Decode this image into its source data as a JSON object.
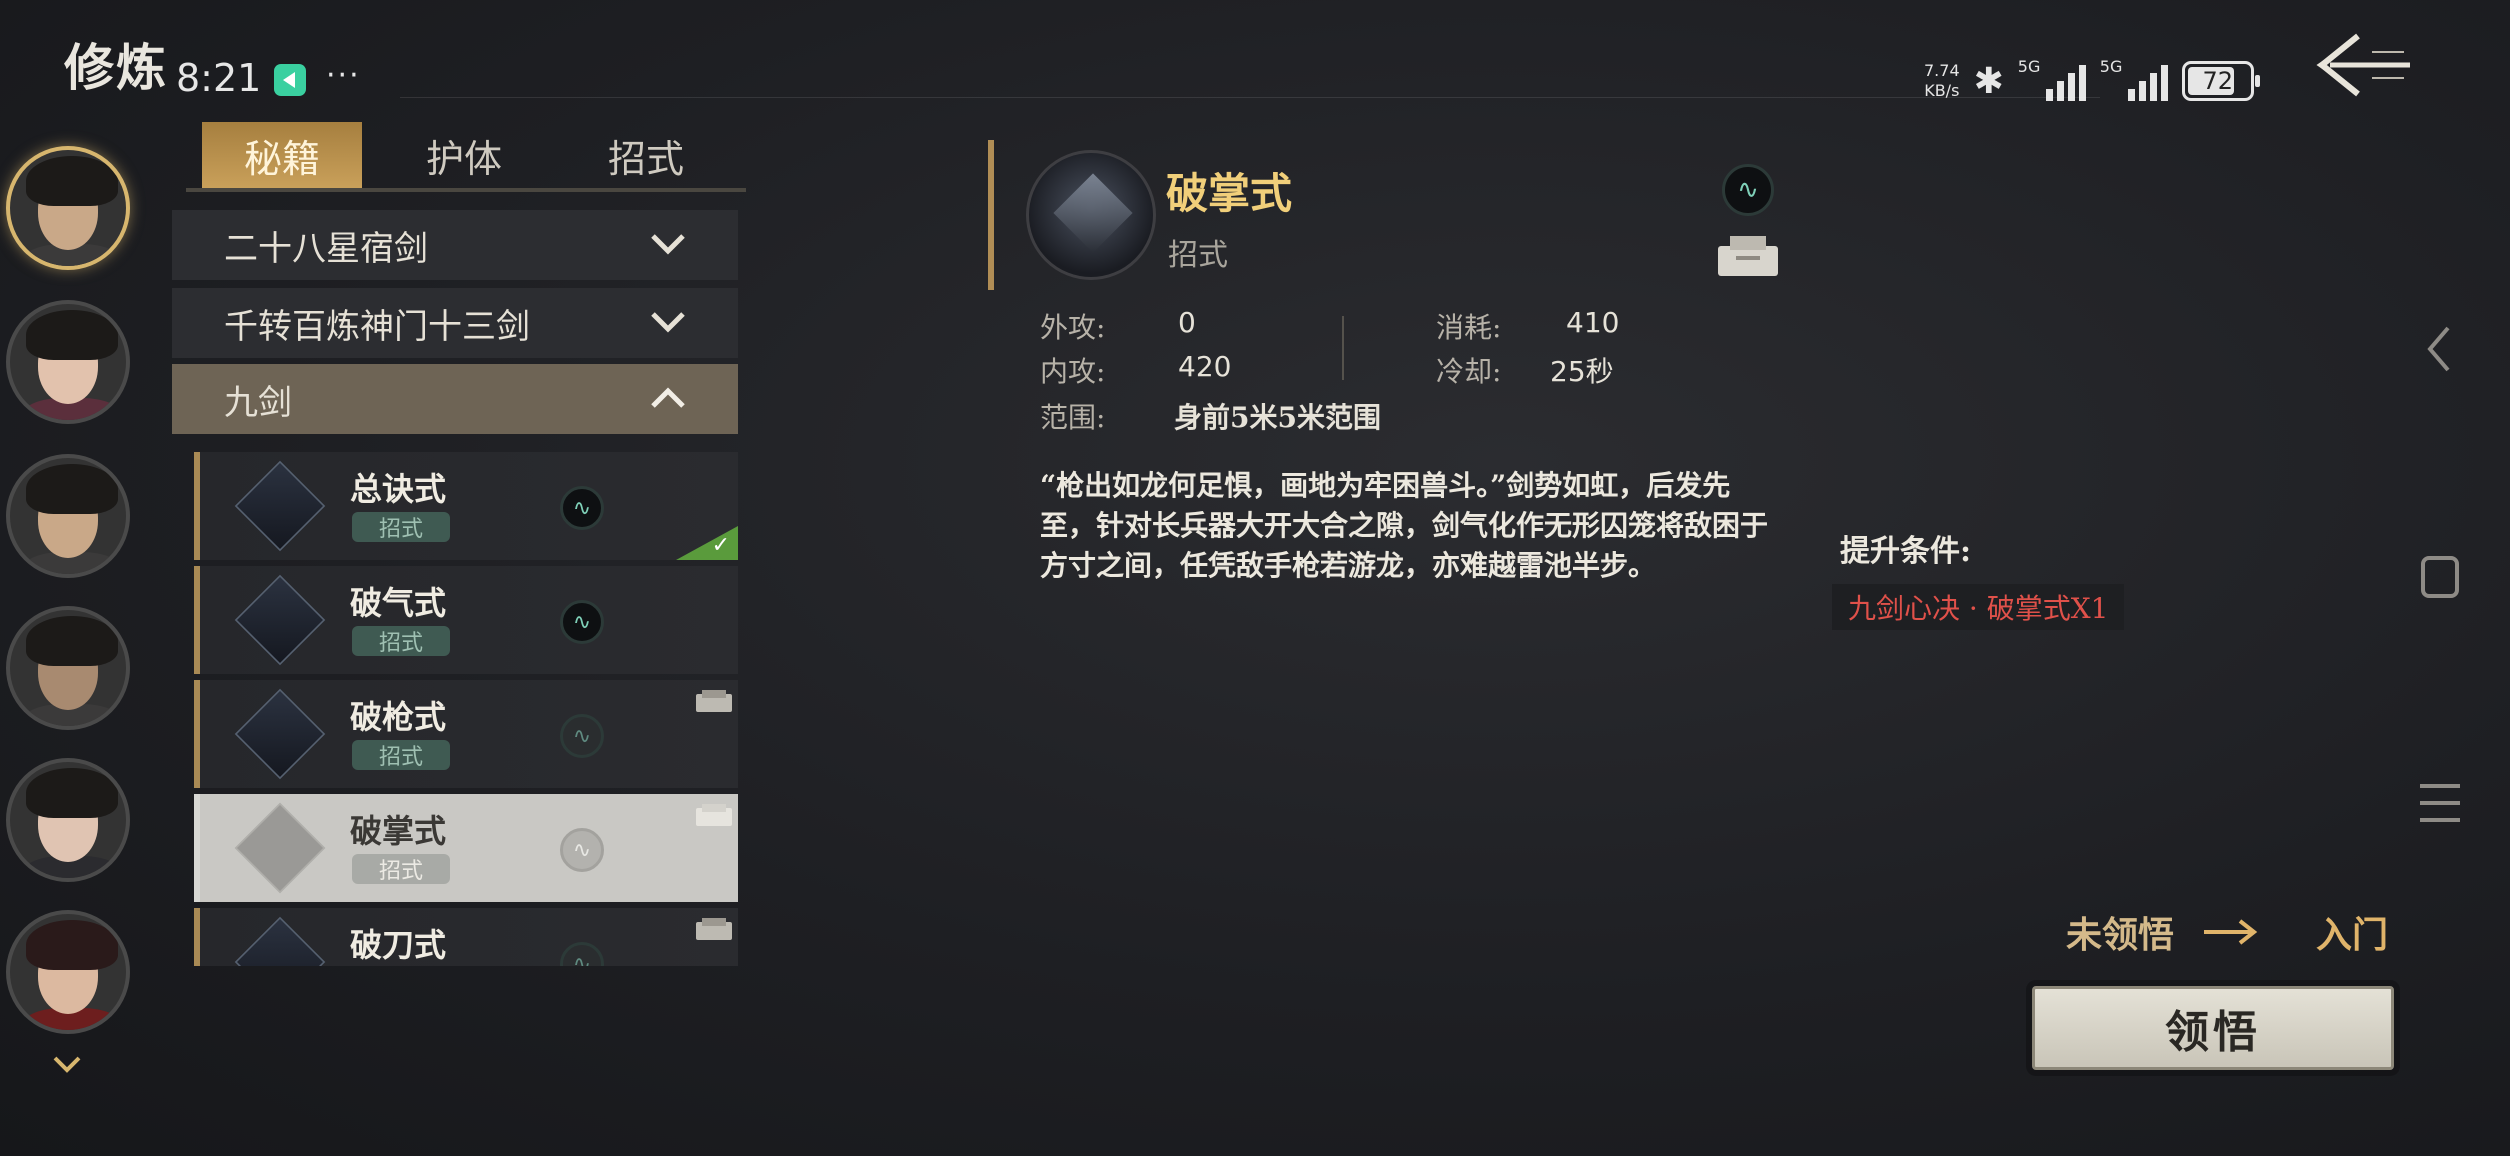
{
  "page": {
    "title": "修炼"
  },
  "status_bar": {
    "time": "8:21",
    "more": "···",
    "net_speed_value": "7.74",
    "net_speed_unit": "KB/s",
    "signal1_label": "5G",
    "signal2_label": "5G",
    "battery": "72"
  },
  "tabs": [
    {
      "label": "秘籍",
      "active": true
    },
    {
      "label": "护体",
      "active": false
    },
    {
      "label": "招式",
      "active": false
    }
  ],
  "categories": [
    {
      "label": "二十八星宿剑",
      "expanded": false
    },
    {
      "label": "千转百炼神门十三剑",
      "expanded": false
    },
    {
      "label": "九剑",
      "expanded": true
    }
  ],
  "skills": [
    {
      "name": "总诀式",
      "tag": "招式",
      "learned": true,
      "has_book": false
    },
    {
      "name": "破气式",
      "tag": "招式",
      "learned": false,
      "has_book": false
    },
    {
      "name": "破枪式",
      "tag": "招式",
      "learned": false,
      "has_book": true
    },
    {
      "name": "破掌式",
      "tag": "招式",
      "learned": false,
      "has_book": true,
      "selected": true
    },
    {
      "name": "破刀式",
      "tag": "招式",
      "learned": false,
      "has_book": true
    }
  ],
  "detail": {
    "name": "破掌式",
    "type": "招式",
    "stats": {
      "outer_attack_label": "外攻:",
      "outer_attack": "0",
      "inner_attack_label": "内攻:",
      "inner_attack": "420",
      "range_label": "范围:",
      "range": "身前5米5米范围",
      "cost_label": "消耗:",
      "cost": "410",
      "cooldown_label": "冷却:",
      "cooldown": "25秒"
    },
    "description": "“枪出如龙何足惧，画地为牢困兽斗。”剑势如虹，后发先至，针对长兵器大开大合之隙，剑气化作无形囚笼将敌困于方寸之间，任凭敌手枪若游龙，亦难越雷池半步。"
  },
  "upgrade": {
    "title": "提升条件:",
    "requirement": "九剑心决 · 破掌式X1"
  },
  "progress": {
    "current": "未领悟",
    "next": "入门"
  },
  "actions": {
    "comprehend": "领悟"
  },
  "colors": {
    "accent_gold": "#c9a05a",
    "title_gold": "#f1cf7a",
    "requirement_red": "#e0514a"
  }
}
